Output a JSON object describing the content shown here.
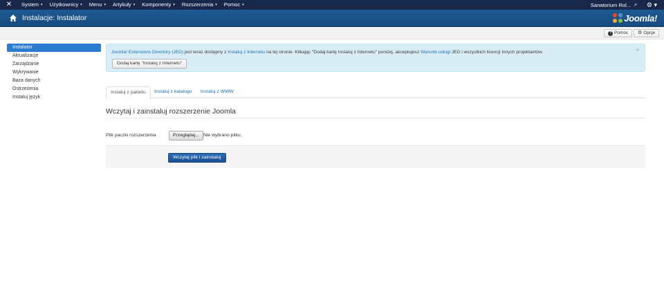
{
  "navbar": {
    "logo_icon": "joomla-icon",
    "menu": [
      {
        "label": "System"
      },
      {
        "label": "Użytkownicy"
      },
      {
        "label": "Menu"
      },
      {
        "label": "Artykuły"
      },
      {
        "label": "Komponenty"
      },
      {
        "label": "Rozszerzenia"
      },
      {
        "label": "Pomoc"
      }
    ],
    "caret": "▾",
    "site_name": "Sanatorium Rol...",
    "external_icon": "↗",
    "settings_icon": "⚙ ▾"
  },
  "header": {
    "title": "Instalacje: Instalator",
    "brand": "Joomla!"
  },
  "toolbar": {
    "help_label": "Pomoc",
    "help_icon": "?",
    "options_label": "Opcje",
    "options_icon": "⚙"
  },
  "sidebar": {
    "items": [
      {
        "label": "Instalator",
        "active": true
      },
      {
        "label": "Aktualizacje"
      },
      {
        "label": "Zarządzanie"
      },
      {
        "label": "Wykrywanie"
      },
      {
        "label": "Baza danych"
      },
      {
        "label": "Ostrzeżenia"
      },
      {
        "label": "Instaluj język"
      }
    ]
  },
  "alert": {
    "link_jed": "Joomla! Extensions Directory (JED)",
    "text_1": " jest teraz dostępny z ",
    "link_install": "Instaluj z Internetu",
    "text_2": " na tej stronie.  Klikając \"Dodaj kartę Instaluj z Internetu\" poniżej, akceptujesz ",
    "link_terms": "Warunki usługi",
    "text_3": " JED i wszystkich licencji innych projektantów.",
    "button_label": "Dodaj kartę \"Instaluj z Internetu\"",
    "close": "×"
  },
  "tabs": [
    {
      "label": "Instaluj z pakietu",
      "active": true
    },
    {
      "label": "Instaluj z katalogu"
    },
    {
      "label": "Instaluj z WWW"
    }
  ],
  "upload": {
    "section_title": "Wczytaj i zainstaluj rozszerzenie Joomla",
    "field_label": "Plik paczki rozszerzenia",
    "browse_label": "Przeglądaj...",
    "file_status": "Nie wybrano pliku.",
    "submit_label": "Wczytaj plik i zainstaluj"
  },
  "colors": {
    "navbar": "#17284a",
    "header": "#1e5a92",
    "accent": "#2b7bd1",
    "alert_bg": "#d9edf7"
  }
}
